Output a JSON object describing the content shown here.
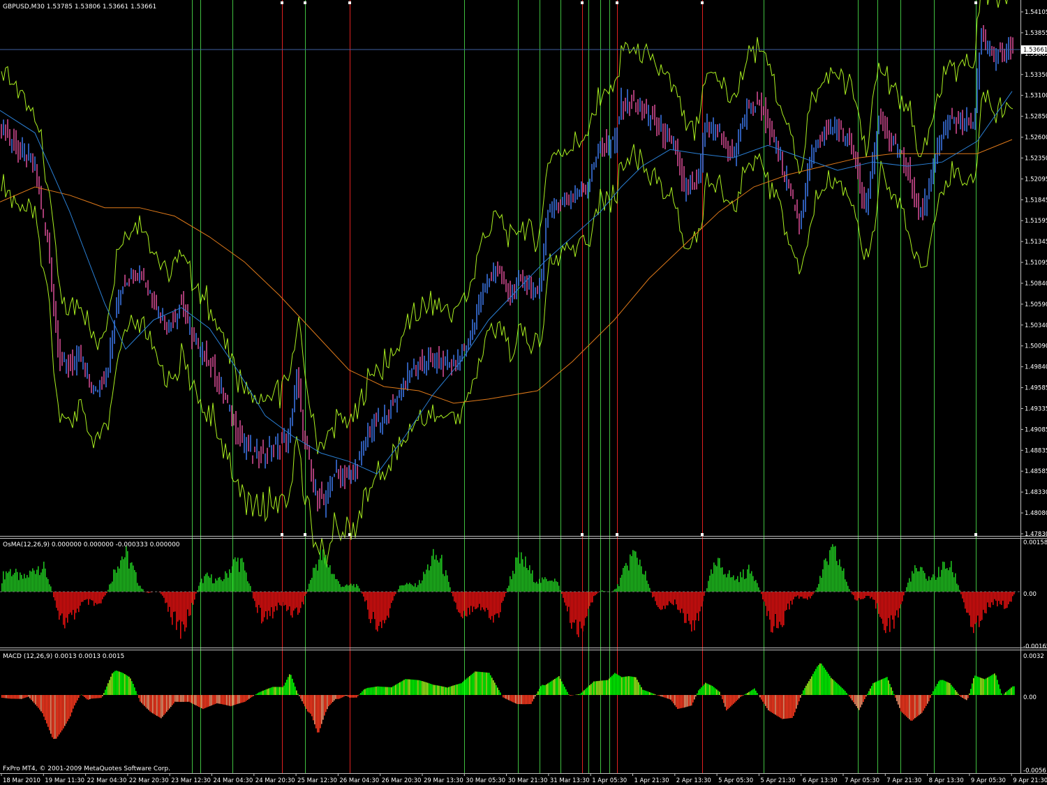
{
  "symbol_header": "GBPUSD,M30  1.53785 1.53806 1.53661 1.53661",
  "current_price_tag": "1.53661",
  "copyright": "FxPro MT4, © 2001-2009 MetaQuotes Software Corp.",
  "osma_label": "OsMA(12,26,9) 0.000000 0.000000 -0.000333 0.000000",
  "macd_label": "MACD (12,26,9) 0.0013 0.0013 0.0015",
  "price_axis": [
    "1.54105",
    "1.53855",
    "1.53605",
    "1.53350",
    "1.53100",
    "1.52850",
    "1.52600",
    "1.52350",
    "1.52095",
    "1.51845",
    "1.51595",
    "1.51345",
    "1.51095",
    "1.50840",
    "1.50590",
    "1.50340",
    "1.50090",
    "1.49840",
    "1.49585",
    "1.49335",
    "1.49085",
    "1.48835",
    "1.48585",
    "1.48330",
    "1.48080",
    "1.47830"
  ],
  "osma_axis": [
    "0.001582",
    "0.00",
    "-0.00165"
  ],
  "macd_axis": [
    "0.0032",
    "0.00",
    "-0.0056"
  ],
  "time_axis": [
    "18 Mar 2010",
    "19 Mar 11:30",
    "22 Mar 04:30",
    "22 Mar 20:30",
    "23 Mar 12:30",
    "24 Mar 04:30",
    "24 Mar 20:30",
    "25 Mar 12:30",
    "26 Mar 04:30",
    "26 Mar 20:30",
    "29 Mar 13:30",
    "30 Mar 05:30",
    "30 Mar 21:30",
    "31 Mar 13:30",
    "1 Apr 05:30",
    "1 Apr 21:30",
    "2 Apr 13:30",
    "5 Apr 05:30",
    "5 Apr 21:30",
    "6 Apr 13:30",
    "7 Apr 05:30",
    "7 Apr 21:30",
    "8 Apr 13:30",
    "9 Apr 05:30",
    "9 Apr 21:30"
  ],
  "chart_data": {
    "type": "candlestick",
    "symbol": "GBPUSD",
    "timeframe": "M30",
    "last_bar": {
      "open": 1.53785,
      "high": 1.53806,
      "low": 1.53661,
      "close": 1.53661
    },
    "y_range": [
      1.4783,
      1.5423
    ],
    "close_path": [
      [
        0,
        1.5275
      ],
      [
        25,
        1.5245
      ],
      [
        50,
        1.5225
      ],
      [
        70,
        1.512
      ],
      [
        85,
        1.499
      ],
      [
        100,
        1.4985
      ],
      [
        115,
        1.4995
      ],
      [
        135,
        1.495
      ],
      [
        155,
        1.4985
      ],
      [
        170,
        1.5075
      ],
      [
        185,
        1.5095
      ],
      [
        200,
        1.51
      ],
      [
        220,
        1.5065
      ],
      [
        240,
        1.503
      ],
      [
        260,
        1.506
      ],
      [
        280,
        1.501
      ],
      [
        300,
        1.499
      ],
      [
        320,
        1.495
      ],
      [
        340,
        1.4905
      ],
      [
        360,
        1.488
      ],
      [
        380,
        1.488
      ],
      [
        400,
        1.489
      ],
      [
        415,
        1.49
      ],
      [
        425,
        1.4975
      ],
      [
        435,
        1.49
      ],
      [
        450,
        1.4835
      ],
      [
        465,
        1.482
      ],
      [
        480,
        1.486
      ],
      [
        495,
        1.485
      ],
      [
        510,
        1.486
      ],
      [
        530,
        1.491
      ],
      [
        550,
        1.492
      ],
      [
        570,
        1.495
      ],
      [
        590,
        1.498
      ],
      [
        610,
        1.499
      ],
      [
        630,
        1.499
      ],
      [
        650,
        1.4985
      ],
      [
        670,
        1.501
      ],
      [
        690,
        1.507
      ],
      [
        710,
        1.5105
      ],
      [
        730,
        1.507
      ],
      [
        750,
        1.509
      ],
      [
        770,
        1.5065
      ],
      [
        785,
        1.517
      ],
      [
        800,
        1.518
      ],
      [
        820,
        1.519
      ],
      [
        840,
        1.52
      ],
      [
        860,
        1.525
      ],
      [
        880,
        1.525
      ],
      [
        890,
        1.53
      ],
      [
        910,
        1.53
      ],
      [
        930,
        1.5285
      ],
      [
        950,
        1.5265
      ],
      [
        970,
        1.524
      ],
      [
        980,
        1.5195
      ],
      [
        1000,
        1.5205
      ],
      [
        1010,
        1.527
      ],
      [
        1030,
        1.5265
      ],
      [
        1050,
        1.5235
      ],
      [
        1070,
        1.5295
      ],
      [
        1090,
        1.53
      ],
      [
        1110,
        1.525
      ],
      [
        1130,
        1.52
      ],
      [
        1145,
        1.5155
      ],
      [
        1160,
        1.523
      ],
      [
        1180,
        1.527
      ],
      [
        1200,
        1.527
      ],
      [
        1220,
        1.525
      ],
      [
        1240,
        1.517
      ],
      [
        1260,
        1.5285
      ],
      [
        1280,
        1.525
      ],
      [
        1300,
        1.5225
      ],
      [
        1315,
        1.5165
      ],
      [
        1330,
        1.519
      ],
      [
        1345,
        1.5255
      ],
      [
        1360,
        1.528
      ],
      [
        1380,
        1.528
      ],
      [
        1395,
        1.527
      ],
      [
        1405,
        1.5385
      ],
      [
        1420,
        1.5355
      ],
      [
        1435,
        1.536
      ],
      [
        1450,
        1.5366
      ]
    ],
    "ma_fast_path": [
      [
        0,
        1.5292
      ],
      [
        50,
        1.5265
      ],
      [
        100,
        1.517
      ],
      [
        150,
        1.506
      ],
      [
        180,
        1.5005
      ],
      [
        220,
        1.504
      ],
      [
        260,
        1.5055
      ],
      [
        300,
        1.503
      ],
      [
        340,
        1.498
      ],
      [
        380,
        1.4925
      ],
      [
        420,
        1.49
      ],
      [
        460,
        1.488
      ],
      [
        500,
        1.487
      ],
      [
        540,
        1.4855
      ],
      [
        580,
        1.49
      ],
      [
        620,
        1.495
      ],
      [
        660,
        1.499
      ],
      [
        700,
        1.504
      ],
      [
        740,
        1.5075
      ],
      [
        780,
        1.511
      ],
      [
        820,
        1.514
      ],
      [
        860,
        1.517
      ],
      [
        890,
        1.52
      ],
      [
        920,
        1.5225
      ],
      [
        960,
        1.5245
      ],
      [
        1000,
        1.524
      ],
      [
        1050,
        1.5235
      ],
      [
        1100,
        1.525
      ],
      [
        1150,
        1.5235
      ],
      [
        1200,
        1.522
      ],
      [
        1250,
        1.523
      ],
      [
        1300,
        1.5225
      ],
      [
        1350,
        1.523
      ],
      [
        1400,
        1.5255
      ],
      [
        1450,
        1.5315
      ]
    ],
    "ma_slow_path": [
      [
        0,
        1.5182
      ],
      [
        50,
        1.52
      ],
      [
        100,
        1.519
      ],
      [
        150,
        1.5175
      ],
      [
        200,
        1.5175
      ],
      [
        250,
        1.5165
      ],
      [
        300,
        1.514
      ],
      [
        350,
        1.511
      ],
      [
        400,
        1.507
      ],
      [
        450,
        1.5025
      ],
      [
        500,
        1.498
      ],
      [
        550,
        1.496
      ],
      [
        600,
        1.4955
      ],
      [
        650,
        1.494
      ],
      [
        700,
        1.4945
      ],
      [
        770,
        1.4955
      ],
      [
        820,
        1.499
      ],
      [
        880,
        1.504
      ],
      [
        930,
        1.509
      ],
      [
        980,
        1.513
      ],
      [
        1030,
        1.517
      ],
      [
        1080,
        1.52
      ],
      [
        1130,
        1.5215
      ],
      [
        1180,
        1.5225
      ],
      [
        1230,
        1.5235
      ],
      [
        1280,
        1.524
      ],
      [
        1330,
        1.524
      ],
      [
        1400,
        1.524
      ],
      [
        1450,
        1.5257
      ]
    ],
    "osma_range": [
      -0.00165,
      0.001582
    ],
    "macd_range": [
      -0.0056,
      0.0032
    ],
    "macd_pos_color": "#00ff00",
    "macd_neg_color": "#ff3a1f",
    "osma_pos_color": "#1fbf1f",
    "osma_neg_color": "#e01010"
  },
  "colors": {
    "background": "#000000",
    "grid_axis": "#c0c0c0",
    "vline_green": "#40c040",
    "vline_red": "#e02020",
    "envelope": "#aaf020",
    "ma_fast": "#2a7fd4",
    "ma_slow": "#e07a1a",
    "price_line": "#4060a0"
  }
}
